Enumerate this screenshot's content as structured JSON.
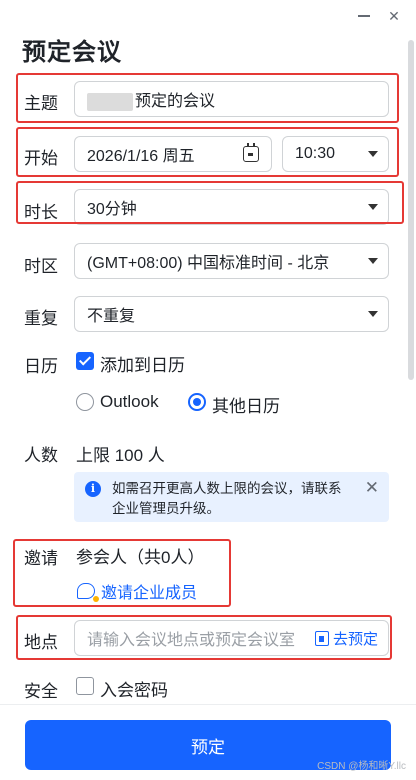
{
  "window": {
    "minimize_icon": "minimize-icon",
    "close_label": "✕"
  },
  "title": "预定会议",
  "subject": {
    "label": "主题",
    "value": "预定的会议"
  },
  "start": {
    "label": "开始",
    "date": "2026/1/16 周五",
    "time": "10:30"
  },
  "duration": {
    "label": "时长",
    "value": "30分钟"
  },
  "timezone": {
    "label": "时区",
    "value": "(GMT+08:00) 中国标准时间 - 北京"
  },
  "repeat": {
    "label": "重复",
    "value": "不重复"
  },
  "calendar": {
    "label": "日历",
    "add_label": "添加到日历",
    "add_checked": true,
    "options": [
      "Outlook",
      "其他日历"
    ],
    "selected": "其他日历"
  },
  "capacity": {
    "label": "人数",
    "value": "上限 100 人",
    "notice": "如需召开更高人数上限的会议，请联系企业管理员升级。",
    "notice_close": "✕"
  },
  "invite": {
    "label": "邀请",
    "participants": "参会人（共0人）",
    "link": "邀请企业成员"
  },
  "location": {
    "label": "地点",
    "placeholder": "请输入会议地点或预定会议室",
    "button": "去预定"
  },
  "security": {
    "label": "安全",
    "password_label": "入会密码",
    "password_checked": false
  },
  "submit_label": "预定",
  "watermark": "CSDN @杨和晰Y.llc",
  "colors": {
    "accent": "#1664ff",
    "highlight_box": "#e53935",
    "notice_bg": "#e8f1ff"
  }
}
